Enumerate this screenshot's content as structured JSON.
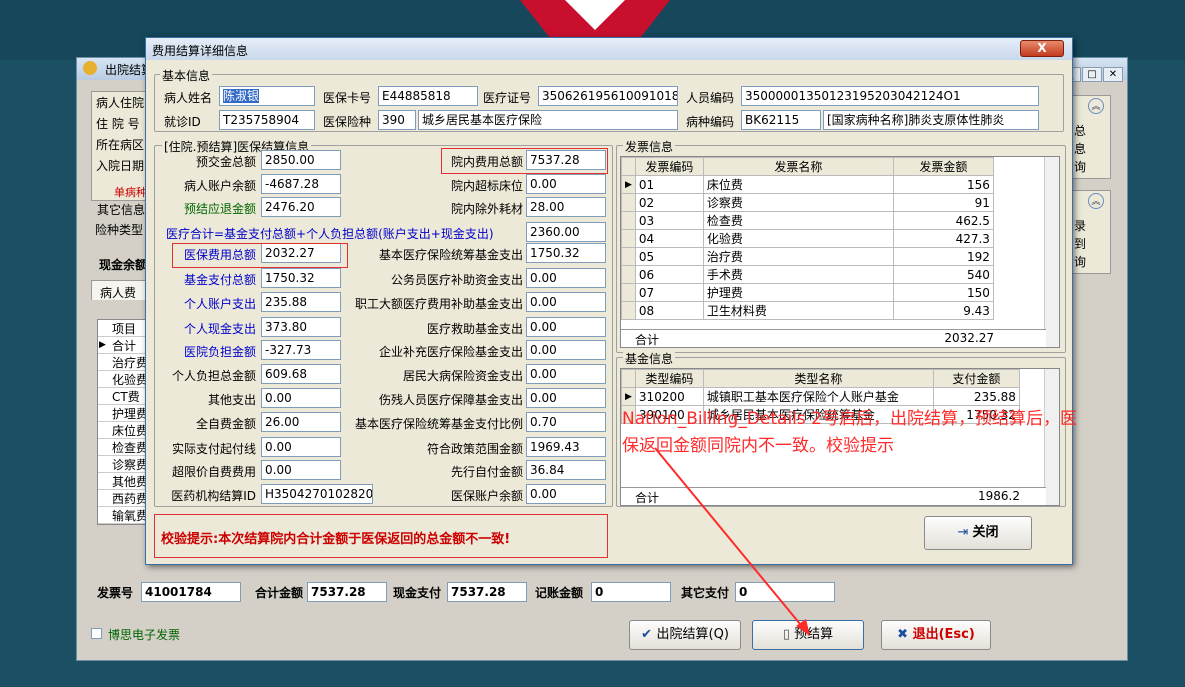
{
  "back": {
    "title": "出院结算",
    "section_labels": [
      "病人住院",
      "住 院 号",
      "所在病区",
      "入院日期"
    ],
    "single_disease": "单病种",
    "other_info": "其它信息",
    "insurance_type": "险种类型",
    "cash_tab": "现金余额",
    "patient_fee_tab": "病人费",
    "fee_items": [
      "项目",
      "合计",
      "治疗费",
      "化验费",
      "CT费",
      "护理费",
      "床位费",
      "检查费",
      "诊察费",
      "其他费",
      "西药费",
      "输氧费"
    ],
    "right_chars_a": [
      "总",
      "息",
      "询"
    ],
    "right_chars_b": [
      "录",
      "到",
      "询"
    ],
    "invoice_no_label": "发票号",
    "invoice_no": "41001784",
    "total_label": "合计金额",
    "total": "7537.28",
    "cash_pay_label": "现金支付",
    "cash_pay": "7537.28",
    "account_label": "记账金额",
    "account": "0",
    "other_pay_label": "其它支付",
    "other_pay": "0",
    "boss_invoice": "博思电子发票",
    "btn_discharge": "出院结算(Q)",
    "btn_presettle": "预结算",
    "btn_exit": "退出(Esc)"
  },
  "dialog": {
    "title": "费用结算详细信息",
    "basic": {
      "legend": "基本信息",
      "name_label": "病人姓名",
      "name": "陈淑银",
      "card_label": "医保卡号",
      "card": "E44885818",
      "cert_label": "医疗证号",
      "cert": "350626195610091018",
      "person_label": "人员编码",
      "person": "35000001350123195203042124O1",
      "visit_label": "就诊ID",
      "visit": "T235758904",
      "type_label": "医保险种",
      "type_code": "390",
      "type_name": "城乡居民基本医疗保险",
      "disease_label": "病种编码",
      "disease_code": "BK62115",
      "disease_name": "[国家病种名称]肺炎支原体性肺炎"
    },
    "settle": {
      "legend": "[住院.预结算]医保结算信息",
      "formula": "医疗合计=基金支付总额+个人负担总额(账户支出+现金支出)",
      "formula_value": "2360.00",
      "left": [
        {
          "label": "预交金总额",
          "value": "2850.00",
          "color": "black"
        },
        {
          "label": "病人账户余额",
          "value": "-4687.28",
          "color": "black"
        },
        {
          "label": "预结应退金额",
          "value": "2476.20",
          "color": "green"
        },
        {
          "label": "医保费用总额",
          "value": "2032.27",
          "color": "blue"
        },
        {
          "label": "基金支付总额",
          "value": "1750.32",
          "color": "blue"
        },
        {
          "label": "个人账户支出",
          "value": "235.88",
          "color": "blue"
        },
        {
          "label": "个人现金支出",
          "value": "373.80",
          "color": "blue"
        },
        {
          "label": "医院负担金额",
          "value": "-327.73",
          "color": "blue"
        },
        {
          "label": "个人负担总金额",
          "value": "609.68",
          "color": "black"
        },
        {
          "label": "其他支出",
          "value": "0.00",
          "color": "black"
        },
        {
          "label": "全自费金额",
          "value": "26.00",
          "color": "black"
        },
        {
          "label": "实际支付起付线",
          "value": "0.00",
          "color": "black"
        },
        {
          "label": "超限价自费费用",
          "value": "0.00",
          "color": "black"
        },
        {
          "label": "医药机构结算ID",
          "value": "H35042701028202203141003",
          "color": "black"
        }
      ],
      "right": [
        {
          "label": "院内费用总额",
          "value": "7537.28"
        },
        {
          "label": "院内超标床位",
          "value": "0.00"
        },
        {
          "label": "院内除外耗材",
          "value": "28.00"
        },
        {
          "label": "基本医疗保险统筹基金支出",
          "value": "1750.32"
        },
        {
          "label": "公务员医疗补助资金支出",
          "value": "0.00"
        },
        {
          "label": "职工大额医疗费用补助基金支出",
          "value": "0.00"
        },
        {
          "label": "医疗救助基金支出",
          "value": "0.00"
        },
        {
          "label": "企业补充医疗保险基金支出",
          "value": "0.00"
        },
        {
          "label": "居民大病保险资金支出",
          "value": "0.00"
        },
        {
          "label": "伤残人员医疗保障基金支出",
          "value": "0.00"
        },
        {
          "label": "基本医疗保险统筹基金支付比例",
          "value": "0.70"
        },
        {
          "label": "符合政策范围金额",
          "value": "1969.43"
        },
        {
          "label": "先行自付金额",
          "value": "36.84"
        },
        {
          "label": "医保账户余额",
          "value": "0.00"
        }
      ]
    },
    "invoice": {
      "legend": "发票信息",
      "headers": [
        "发票编码",
        "发票名称",
        "发票金额"
      ],
      "rows": [
        [
          "01",
          "床位费",
          "156"
        ],
        [
          "02",
          "诊察费",
          "91"
        ],
        [
          "03",
          "检查费",
          "462.5"
        ],
        [
          "04",
          "化验费",
          "427.3"
        ],
        [
          "05",
          "治疗费",
          "192"
        ],
        [
          "06",
          "手术费",
          "540"
        ],
        [
          "07",
          "护理费",
          "150"
        ],
        [
          "08",
          "卫生材料费",
          "9.43"
        ]
      ],
      "total_label": "合计",
      "total": "2032.27"
    },
    "fund": {
      "legend": "基金信息",
      "headers": [
        "类型编码",
        "类型名称",
        "支付金额"
      ],
      "rows": [
        [
          "310200",
          "城镇职工基本医疗保险个人账户基金",
          "235.88"
        ],
        [
          "390100",
          "城乡居民基本医疗保险统筹基金",
          "1750.32"
        ]
      ],
      "total_label": "合计",
      "total": "1986.2"
    },
    "annotation": "Nation_Billing_Details 2号启后，出院结算，预结算后，医保返回金额同院内不一致。校验提示",
    "warning": "校验提示:本次结算院内合计金额于医保返回的总金额不一致!",
    "close_btn": "关闭",
    "close_x": "X"
  }
}
